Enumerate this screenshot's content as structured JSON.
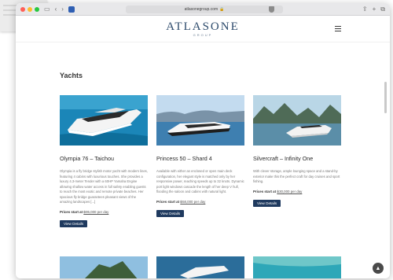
{
  "browser": {
    "url": "atlasonegroup.com",
    "lock_icon": "🔒",
    "icons": [
      "sidebar-icon",
      "back-icon",
      "forward-icon",
      "share-icon",
      "new-tab-icon",
      "tabs-icon"
    ]
  },
  "site": {
    "logo": "ATLASONE",
    "logo_sub": "GROUP",
    "brand_color": "#2c4a6b",
    "button_color": "#1f3a5f"
  },
  "page": {
    "title": "Yachts"
  },
  "yachts": [
    {
      "title": "Olympia 76 – Taichou",
      "description": "Olympia is a fly bridge stylish motor yacht with modern lines, featuring 4 cabins with luxurious touches. She provides a luxury 4.3-meter Tender with a 60HP Yamaha Engine allowing shallow water access in full safety enabling guests to reach the most exotic and remote private beaches. Her spacious fly bridge guarantees pleasant views of the amazing landscapes [...]",
      "price_label": "Prices start at",
      "price": "฿95,000 per day",
      "button": "View Details"
    },
    {
      "title": "Princess 50 – Shard 4",
      "description": "Available with either an enclosed or open main deck configuration, her elegant style is matched only by her responsive power, reaching speeds up to 32 knots. Dynamic port light windows cascade the length of her deep V hull, flooding the saloon and cabins with natural light.",
      "price_label": "Prices start at",
      "price": "฿58,000 per day",
      "button": "View Details"
    },
    {
      "title": "Silvercraft – Infinity One",
      "description": "With clever storage, ample lounging space and a stand-by exterior make this the perfect craft for day cruises and sport fishing.",
      "price_label": "Prices start at",
      "price": "฿30,000 per day",
      "button": "View Details"
    }
  ]
}
